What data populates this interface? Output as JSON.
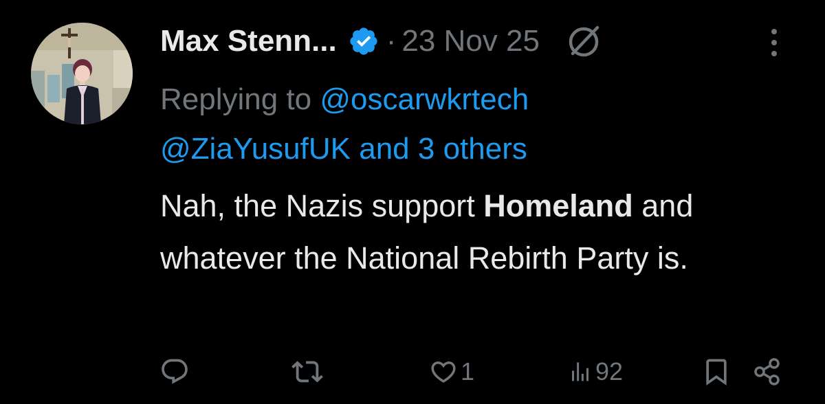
{
  "author": {
    "display_name": "Max Stenn...",
    "verified": true,
    "verified_color": "#1d9bf0",
    "avatar_icon": "profile-photo"
  },
  "separator": "·",
  "date": "23 Nov 25",
  "header_icons": [
    "grok-icon",
    "more-icon"
  ],
  "reply": {
    "prefix": "Replying to ",
    "mention_1": "@oscarwkrtech",
    "mention_2": "@ZiaYusufUK",
    "conjunction": " and ",
    "others": "3 others"
  },
  "body": {
    "part_1": "Nah, the Nazis support ",
    "bold": "Homeland",
    "part_2": " and whatever the National Rebirth Party is."
  },
  "actions": {
    "reply_icon": "reply-icon",
    "repost_icon": "repost-icon",
    "like_icon": "like-icon",
    "like_count": "1",
    "views_icon": "views-icon",
    "views_count": "92",
    "bookmark_icon": "bookmark-icon",
    "share_icon": "share-icon"
  },
  "colors": {
    "background": "#000000",
    "text": "#e7e9ea",
    "secondary": "#71767b",
    "link": "#1d9bf0"
  }
}
